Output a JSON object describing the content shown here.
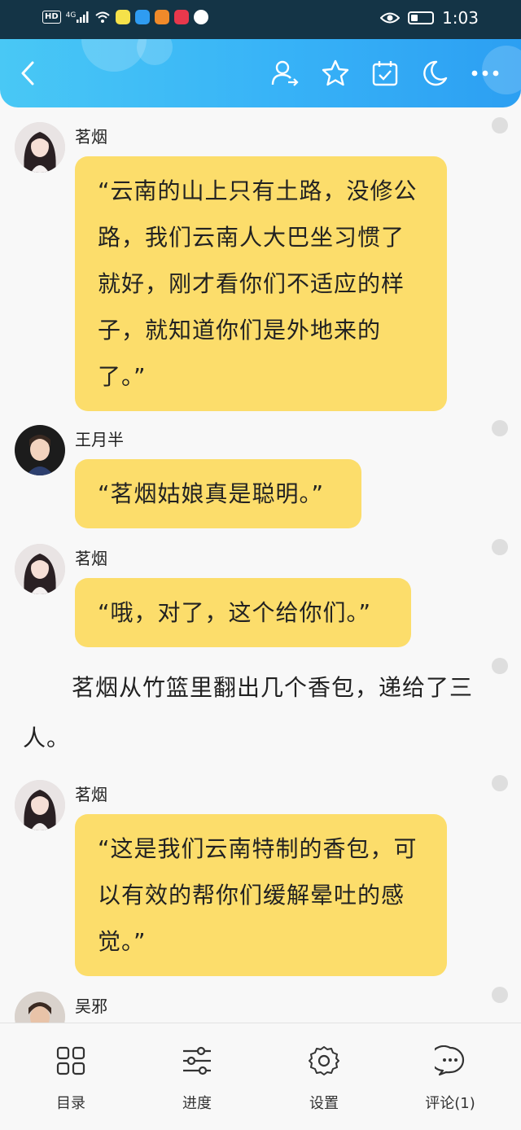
{
  "status_bar": {
    "network": "HD",
    "signal": "4G",
    "time": "1:03"
  },
  "toolbar": {
    "icons": [
      "back-icon",
      "user-switch-icon",
      "star-icon",
      "calendar-check-icon",
      "moon-icon",
      "more-icon"
    ],
    "accent": "#37b2f7"
  },
  "messages": [
    {
      "speaker": "茗烟",
      "text": "“云南的山上只有土路，没修公路，我们云南人大巴坐习惯了就好，刚才看你们不适应的样子，就知道你们是外地来的了。”"
    },
    {
      "speaker": "王月半",
      "text": "“茗烟姑娘真是聪明。”"
    },
    {
      "speaker": "茗烟",
      "text": "“哦，对了，这个给你们。”"
    },
    {
      "narration": "茗烟从竹篮里翻出几个香包，递给了三人。"
    },
    {
      "speaker": "茗烟",
      "text": "“这是我们云南特制的香包，可以有效的帮你们缓解晕吐的感觉。”"
    },
    {
      "speaker": "吴邪"
    }
  ],
  "bubble_color": "#fcdd6b",
  "bottom_nav": {
    "catalog": "目录",
    "progress": "进度",
    "settings": "设置",
    "comments": "评论(1)"
  }
}
